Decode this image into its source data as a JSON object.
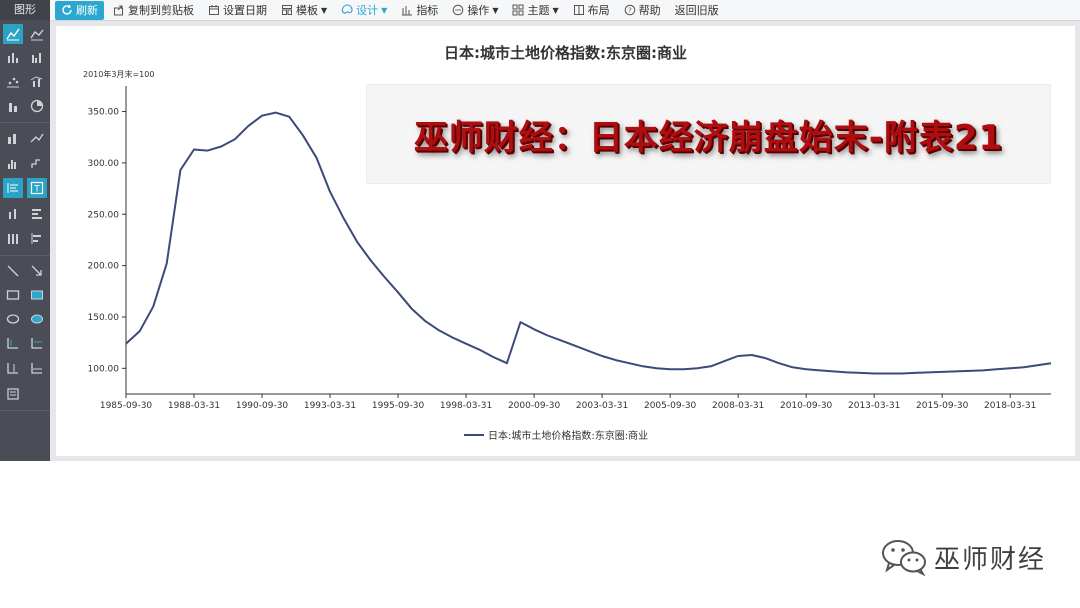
{
  "sidebar": {
    "title": "图形"
  },
  "toolbar": {
    "refresh": "刷新",
    "copy": "复制到剪贴板",
    "set_date": "设置日期",
    "template": "模板",
    "design": "设计",
    "indicator": "指标",
    "operation": "操作",
    "theme": "主题",
    "layout": "布局",
    "help": "帮助",
    "back": "返回旧版"
  },
  "banner": {
    "text": "巫师财经：日本经济崩盘始末-附表21"
  },
  "watermark": {
    "text": "巫师财经"
  },
  "colors": {
    "accent": "#2ca7cf",
    "series": "#3b4a7a",
    "banner_red": "#b00d10"
  },
  "chart_data": {
    "type": "line",
    "title": "日本:城市土地价格指数:东京圈:商业",
    "unit_label": "2010年3月末=100",
    "ylabel": "",
    "xlabel": "",
    "ylim": [
      75,
      370
    ],
    "y_ticks": [
      "100.00",
      "150.00",
      "200.00",
      "250.00",
      "300.00",
      "350.00"
    ],
    "x_tick_labels": [
      "1985-09-30",
      "1988-03-31",
      "1990-09-30",
      "1993-03-31",
      "1995-09-30",
      "1998-03-31",
      "2000-09-30",
      "2003-03-31",
      "2005-09-30",
      "2008-03-31",
      "2010-09-30",
      "2013-03-31",
      "2015-09-30",
      "2018-03-31"
    ],
    "grid": false,
    "legend_position": "bottom",
    "series": [
      {
        "name": "日本:城市土地价格指数:东京圈:商业",
        "x": [
          "1985-09-30",
          "1986-03-31",
          "1986-09-30",
          "1987-03-31",
          "1987-09-30",
          "1988-03-31",
          "1988-09-30",
          "1989-03-31",
          "1989-09-30",
          "1990-03-31",
          "1990-09-30",
          "1991-03-31",
          "1991-09-30",
          "1992-03-31",
          "1992-09-30",
          "1993-03-31",
          "1993-09-30",
          "1994-03-31",
          "1994-09-30",
          "1995-03-31",
          "1995-09-30",
          "1996-03-31",
          "1996-09-30",
          "1997-03-31",
          "1997-09-30",
          "1998-03-31",
          "1998-09-30",
          "1999-03-31",
          "1999-09-30",
          "2000-03-31",
          "2000-09-30",
          "2001-03-31",
          "2001-09-30",
          "2002-03-31",
          "2002-09-30",
          "2003-03-31",
          "2003-09-30",
          "2004-03-31",
          "2004-09-30",
          "2005-03-31",
          "2005-09-30",
          "2006-03-31",
          "2006-09-30",
          "2007-03-31",
          "2007-09-30",
          "2008-03-31",
          "2008-09-30",
          "2009-03-31",
          "2009-09-30",
          "2010-03-31",
          "2010-09-30",
          "2011-03-31",
          "2011-09-30",
          "2012-03-31",
          "2012-09-30",
          "2013-03-31",
          "2013-09-30",
          "2014-03-31",
          "2014-09-30",
          "2015-03-31",
          "2015-09-30",
          "2016-03-31",
          "2016-09-30",
          "2017-03-31",
          "2017-09-30",
          "2018-03-31",
          "2018-09-30",
          "2019-03-31",
          "2019-09-30"
        ],
        "values": [
          124,
          136,
          160,
          202,
          293,
          313,
          312,
          316,
          323,
          336,
          346,
          349,
          345,
          327,
          305,
          272,
          246,
          223,
          205,
          189,
          174,
          158,
          146,
          137,
          130,
          124,
          118,
          111,
          105,
          145,
          138,
          132,
          127,
          122,
          117,
          112,
          108,
          105,
          102,
          100,
          99,
          99,
          100,
          102,
          107,
          112,
          113,
          110,
          105,
          101,
          99,
          98,
          97,
          96,
          95.5,
          95,
          95,
          95,
          95.5,
          96,
          96.5,
          97,
          97.5,
          98,
          99,
          100,
          101,
          103,
          105
        ]
      }
    ]
  }
}
